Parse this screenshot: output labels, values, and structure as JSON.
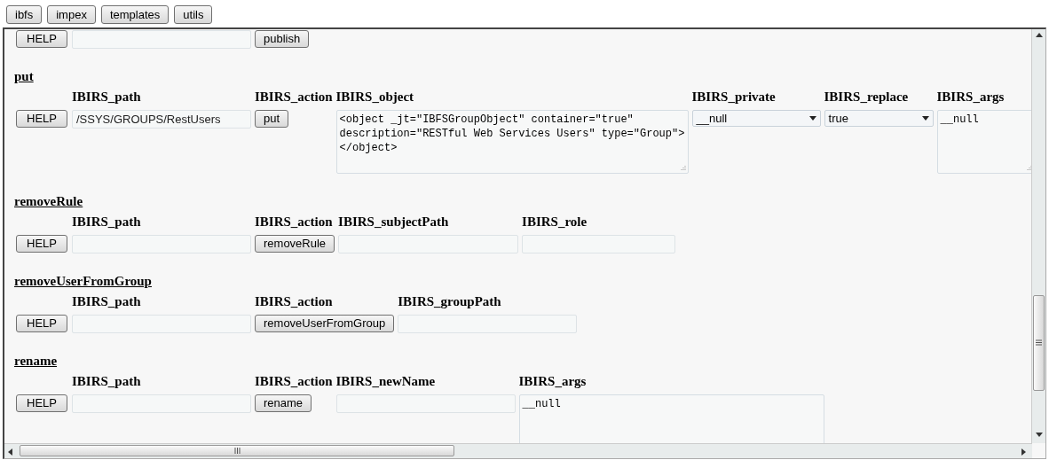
{
  "tabs": [
    {
      "label": "ibfs"
    },
    {
      "label": "impex"
    },
    {
      "label": "templates"
    },
    {
      "label": "utils"
    }
  ],
  "sections": [
    {
      "help_button": "HELP",
      "fields": [
        {
          "kind": "input"
        },
        {
          "kind": "button",
          "text": "publish"
        }
      ]
    },
    {
      "title": "put",
      "help_button": "HELP",
      "fields": [
        {
          "label": "IBIRS_path",
          "kind": "input",
          "value": "/SSYS/GROUPS/RestUsers"
        },
        {
          "label": "IBIRS_action",
          "kind": "button",
          "text": "put"
        },
        {
          "label": "IBIRS_object",
          "kind": "textarea",
          "value": "<object _jt=\"IBFSGroupObject\" container=\"true\" description=\"RESTful Web Services Users\" type=\"Group\"></object>"
        },
        {
          "label": "IBIRS_private",
          "kind": "select",
          "value": "__null"
        },
        {
          "label": "IBIRS_replace",
          "kind": "select",
          "value": "true"
        },
        {
          "label": "IBIRS_args",
          "kind": "textarea",
          "value": "__null"
        }
      ]
    },
    {
      "title": "removeRule",
      "help_button": "HELP",
      "fields": [
        {
          "label": "IBIRS_path",
          "kind": "input"
        },
        {
          "label": "IBIRS_action",
          "kind": "button",
          "text": "removeRule"
        },
        {
          "label": "IBIRS_subjectPath",
          "kind": "input"
        },
        {
          "label": "IBIRS_role",
          "kind": "input"
        }
      ]
    },
    {
      "title": "removeUserFromGroup",
      "help_button": "HELP",
      "fields": [
        {
          "label": "IBIRS_path",
          "kind": "input"
        },
        {
          "label": "IBIRS_action",
          "kind": "button",
          "text": "removeUserFromGroup"
        },
        {
          "label": "IBIRS_groupPath",
          "kind": "input"
        }
      ]
    },
    {
      "title": "rename",
      "help_button": "HELP",
      "fields": [
        {
          "label": "IBIRS_path",
          "kind": "input"
        },
        {
          "label": "IBIRS_action",
          "kind": "button",
          "text": "rename"
        },
        {
          "label": "IBIRS_newName",
          "kind": "input"
        },
        {
          "label": "IBIRS_args",
          "kind": "textarea",
          "value": "__null"
        }
      ]
    }
  ]
}
